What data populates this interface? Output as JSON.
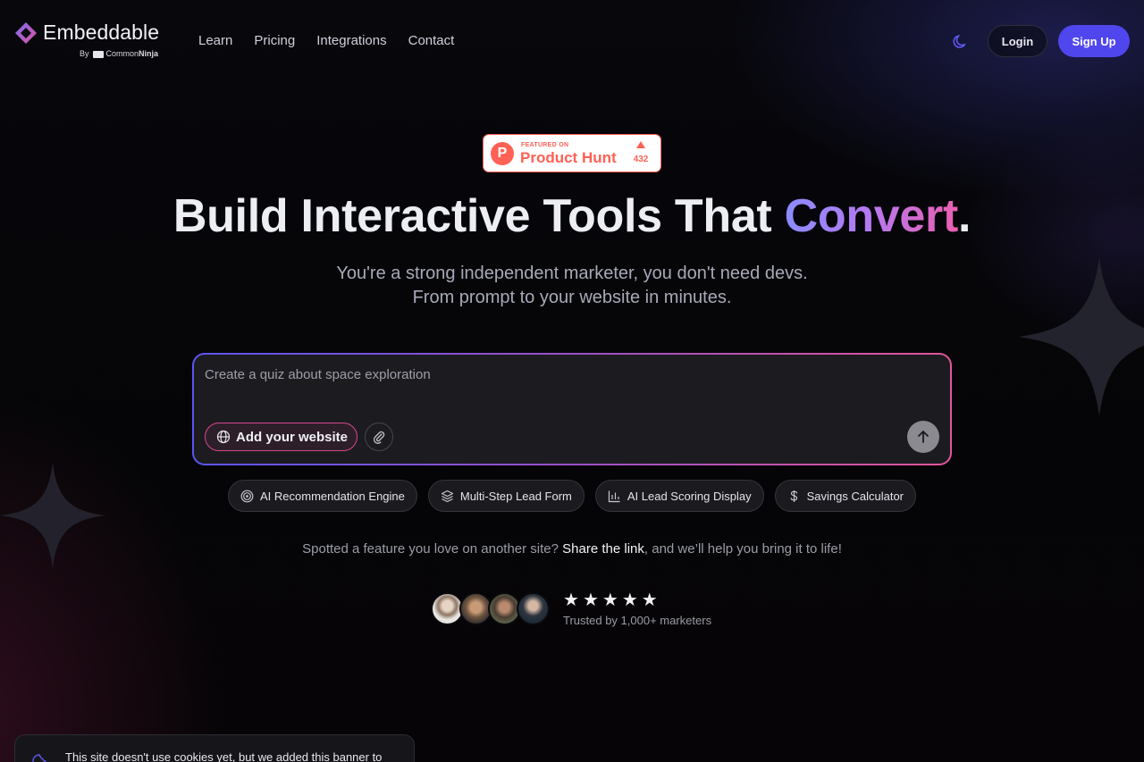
{
  "brand": {
    "name": "Embeddable",
    "by_prefix": "By",
    "by_company_light": "Common",
    "by_company_bold": "Ninja",
    "logo_icon": "diamond-logo-icon"
  },
  "nav": {
    "learn": "Learn",
    "pricing": "Pricing",
    "integrations": "Integrations",
    "contact": "Contact"
  },
  "header": {
    "theme_icon": "moon-icon",
    "login_label": "Login",
    "signup_label": "Sign Up"
  },
  "product_hunt": {
    "featured_on": "FEATURED ON",
    "name": "Product Hunt",
    "votes": "432"
  },
  "hero": {
    "title_main": "Build Interactive Tools That ",
    "title_accent": "Convert",
    "title_end": ".",
    "subtitle_line1": "You're a strong independent marketer, you don't need devs.",
    "subtitle_line2": "From prompt to your website in minutes."
  },
  "prompt": {
    "placeholder": "Create a quiz about space exploration",
    "value": "",
    "add_website_label": "Add your website",
    "attach_icon": "paperclip-icon",
    "send_icon": "arrow-up-icon"
  },
  "chips": [
    {
      "label": "AI Recommendation Engine",
      "icon": "target-icon"
    },
    {
      "label": "Multi-Step Lead Form",
      "icon": "layers-icon"
    },
    {
      "label": "AI Lead Scoring Display",
      "icon": "bar-chart-icon"
    },
    {
      "label": "Savings Calculator",
      "icon": "dollar-icon"
    }
  ],
  "spotted": {
    "before": "Spotted a feature you love on another site? ",
    "link": "Share the link",
    "after": ", and we’ll help you bring it to life!"
  },
  "social_proof": {
    "rating": 5,
    "rating_max": 5,
    "trusted_text": "Trusted by 1,000+ marketers"
  },
  "cookie": {
    "text": "This site doesn't use cookies yet, but we added this banner to"
  },
  "colors": {
    "accent_indigo": "#5046ee",
    "gradient_start": "#8b8bff",
    "gradient_end": "#ec5fb0",
    "product_hunt": "#ff6154"
  }
}
